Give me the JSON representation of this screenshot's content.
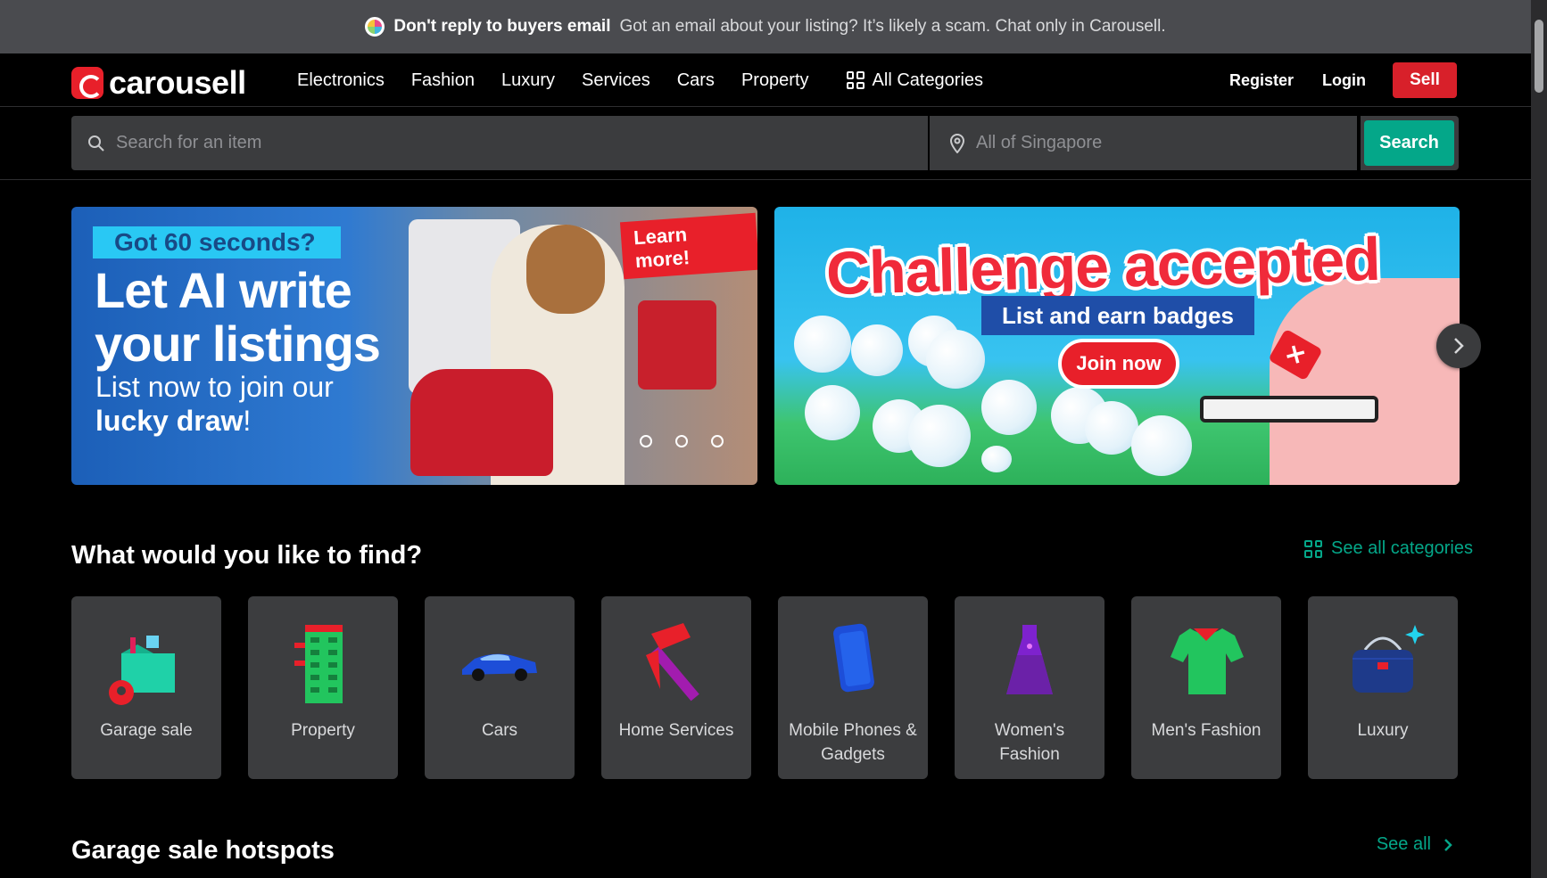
{
  "notice": {
    "title": "Don't reply to buyers email",
    "message": "Got an email about your listing? It’s likely a scam. Chat only in Carousell."
  },
  "header": {
    "logo_text": "carousell",
    "nav": [
      "Electronics",
      "Fashion",
      "Luxury",
      "Services",
      "Cars",
      "Property"
    ],
    "all_categories": "All Categories",
    "register": "Register",
    "login": "Login",
    "sell": "Sell"
  },
  "search": {
    "item_placeholder": "Search for an item",
    "location_placeholder": "All of Singapore",
    "button": "Search"
  },
  "banners": {
    "ai": {
      "tag": "Got 60 seconds?",
      "headline": "Let AI write your listings",
      "sub_regular": "List now to join our",
      "sub_bold": "lucky draw",
      "sub_end": "!",
      "cta": "Learn more!"
    },
    "challenge": {
      "headline": "Challenge accepted",
      "ribbon": "List and earn badges",
      "cta": "Join now"
    },
    "next_icon": "chevron-right-icon"
  },
  "categories": {
    "title": "What would you like to find?",
    "see_all": "See all categories",
    "items": [
      {
        "label": "Garage sale",
        "icon": "garage-sale-icon"
      },
      {
        "label": "Property",
        "icon": "building-icon"
      },
      {
        "label": "Cars",
        "icon": "car-icon"
      },
      {
        "label": "Home Services",
        "icon": "hammer-icon"
      },
      {
        "label": "Mobile Phones & Gadgets",
        "icon": "phone-icon"
      },
      {
        "label": "Women's Fashion",
        "icon": "dress-icon"
      },
      {
        "label": "Men's Fashion",
        "icon": "shirt-icon"
      },
      {
        "label": "Luxury",
        "icon": "handbag-icon"
      }
    ]
  },
  "hotspots": {
    "title": "Garage sale hotspots",
    "see_all": "See all"
  },
  "colors": {
    "accent": "#04a789",
    "brand": "#e8202a",
    "tile": "#3c3d3f",
    "notice_bg": "#4a4b4f"
  }
}
